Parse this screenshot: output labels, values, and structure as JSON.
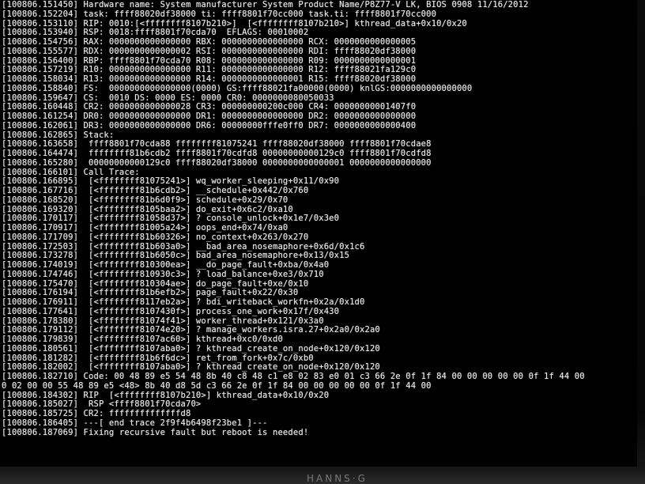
{
  "console": {
    "lines": [
      "[100806.151450] Hardware name: System manufacturer System Product Name/P8Z77-V LK, BIOS 0908 11/16/2012",
      "[100806.152204] task: ffff88020df38000 ti: ffff8801f70cc000 task.ti: ffff8801f70cc000",
      "[100806.153110] RIP: 0010:[<ffffffff8107b210>]  [<ffffffff8107b210>] kthread_data+0x10/0x20",
      "[100806.153940] RSP: 0018:ffff8801f70cda70  EFLAGS: 00010002",
      "[100806.154756] RAX: 0000000000000000 RBX: 0000000000000000 RCX: 0000000000000005",
      "[100806.155577] RDX: 0000000000000002 RSI: 0000000000000000 RDI: ffff88020df38000",
      "[100806.156400] RBP: ffff8801f70cda70 R08: 0000000000000000 R09: 0000000000000001",
      "[100806.157219] R10: 0000000000000000 R11: 0000000000000000 R12: ffff88021fa129c0",
      "[100806.158034] R13: 0000000000000000 R14: 0000000000000001 R15: ffff88020df38000",
      "[100806.158840] FS:  0000000000000000(0000) GS:ffff88021fa00000(0000) knlGS:0000000000000000",
      "[100806.159647] CS:  0010 DS: 0000 ES: 0000 CR0: 0000000080050033",
      "[100806.160448] CR2: 0000000000000028 CR3: 000000000200c000 CR4: 00000000001407f0",
      "[100806.161254] DR0: 0000000000000000 DR1: 0000000000000000 DR2: 0000000000000000",
      "[100806.162061] DR3: 0000000000000000 DR6: 00000000fffe0ff0 DR7: 0000000000000400",
      "[100806.162865] Stack:",
      "[100806.163658]  ffff8801f70cda88 ffffffff81075241 ffff88020df38000 ffff8801f70cdae8",
      "[100806.164474]  ffffffff81b6cdb2 ffff8801f70cdfd8 00000000000129c0 ffff8801f70cdfd8",
      "[100806.165280]  00000000000129c0 ffff88020df38000 0000000000000001 0000000000000000",
      "[100806.166101] Call Trace:",
      "[100806.166895]  [<ffffffff81075241>] wq_worker_sleeping+0x11/0x90",
      "[100806.167716]  [<ffffffff81b6cdb2>] __schedule+0x442/0x760",
      "[100806.168520]  [<ffffffff81b6d0f9>] schedule+0x29/0x70",
      "[100806.169320]  [<ffffffff8105baa2>] do_exit+0x6c2/0xa10",
      "[100806.170117]  [<ffffffff81058d37>] ? console_unlock+0x1e7/0x3e0",
      "[100806.170917]  [<ffffffff81005a24>] oops_end+0x74/0xa0",
      "[100806.171709]  [<ffffffff81b60326>] no_context+0x263/0x270",
      "[100806.172503]  [<ffffffff81b603a0>] __bad_area_nosemaphore+0x6d/0x1c6",
      "[100806.173278]  [<ffffffff81b6050c>] bad_area_nosemaphore+0x13/0x15",
      "[100806.174019]  [<ffffffff810300ea>] __do_page_fault+0xba/0x4a0",
      "[100806.174746]  [<ffffffff810930c3>] ? load_balance+0xe3/0x710",
      "[100806.175470]  [<ffffffff810304ae>] do_page_fault+0xe/0x10",
      "[100806.176194]  [<ffffffff81b6efb2>] page_fault+0x22/0x30",
      "[100806.176911]  [<ffffffff8117eb2a>] ? bdi_writeback_workfn+0x2a/0x1d0",
      "[100806.177641]  [<ffffffff8107430f>] process_one_work+0x17f/0x430",
      "[100806.178380]  [<ffffffff81074f41>] worker_thread+0x121/0x3a0",
      "[100806.179112]  [<ffffffff81074e20>] ? manage_workers.isra.27+0x2a0/0x2a0",
      "[100806.179839]  [<ffffffff8107ac60>] kthread+0xc0/0xd0",
      "[100806.180561]  [<ffffffff8107aba0>] ? kthread_create_on_node+0x120/0x120",
      "[100806.181282]  [<ffffffff81b6f6dc>] ret_from_fork+0x7c/0xb0",
      "[100806.182002]  [<ffffffff8107aba0>] ? kthread_create_on_node+0x120/0x120",
      "[100806.182710] Code: 00 48 89 e5 54 48 8b 40 c8 48 c1 e8 02 83 e0 01 c3 66 2e 0f 1f 84 00 00 00 00 00 0f 1f 44 00",
      "0 02 00 00 55 48 89 e5 <48> 8b 40 d8 5d c3 66 2e 0f 1f 84 00 00 00 00 00 0f 1f 44 00",
      "[100806.184302] RIP  [<ffffffff8107b210>] kthread_data+0x10/0x20",
      "[100806.185027]  RSP <ffff8801f70cda70>",
      "[100806.185725] CR2: ffffffffffffffd8",
      "[100806.186405] ---[ end trace 2f9f4b6498f23be1 ]---",
      "[100806.187069] Fixing recursive fault but reboot is needed!"
    ]
  },
  "monitor": {
    "brand": "HANNS·G"
  },
  "colors": {
    "text": "#e9e9e9",
    "background": "#000000"
  }
}
